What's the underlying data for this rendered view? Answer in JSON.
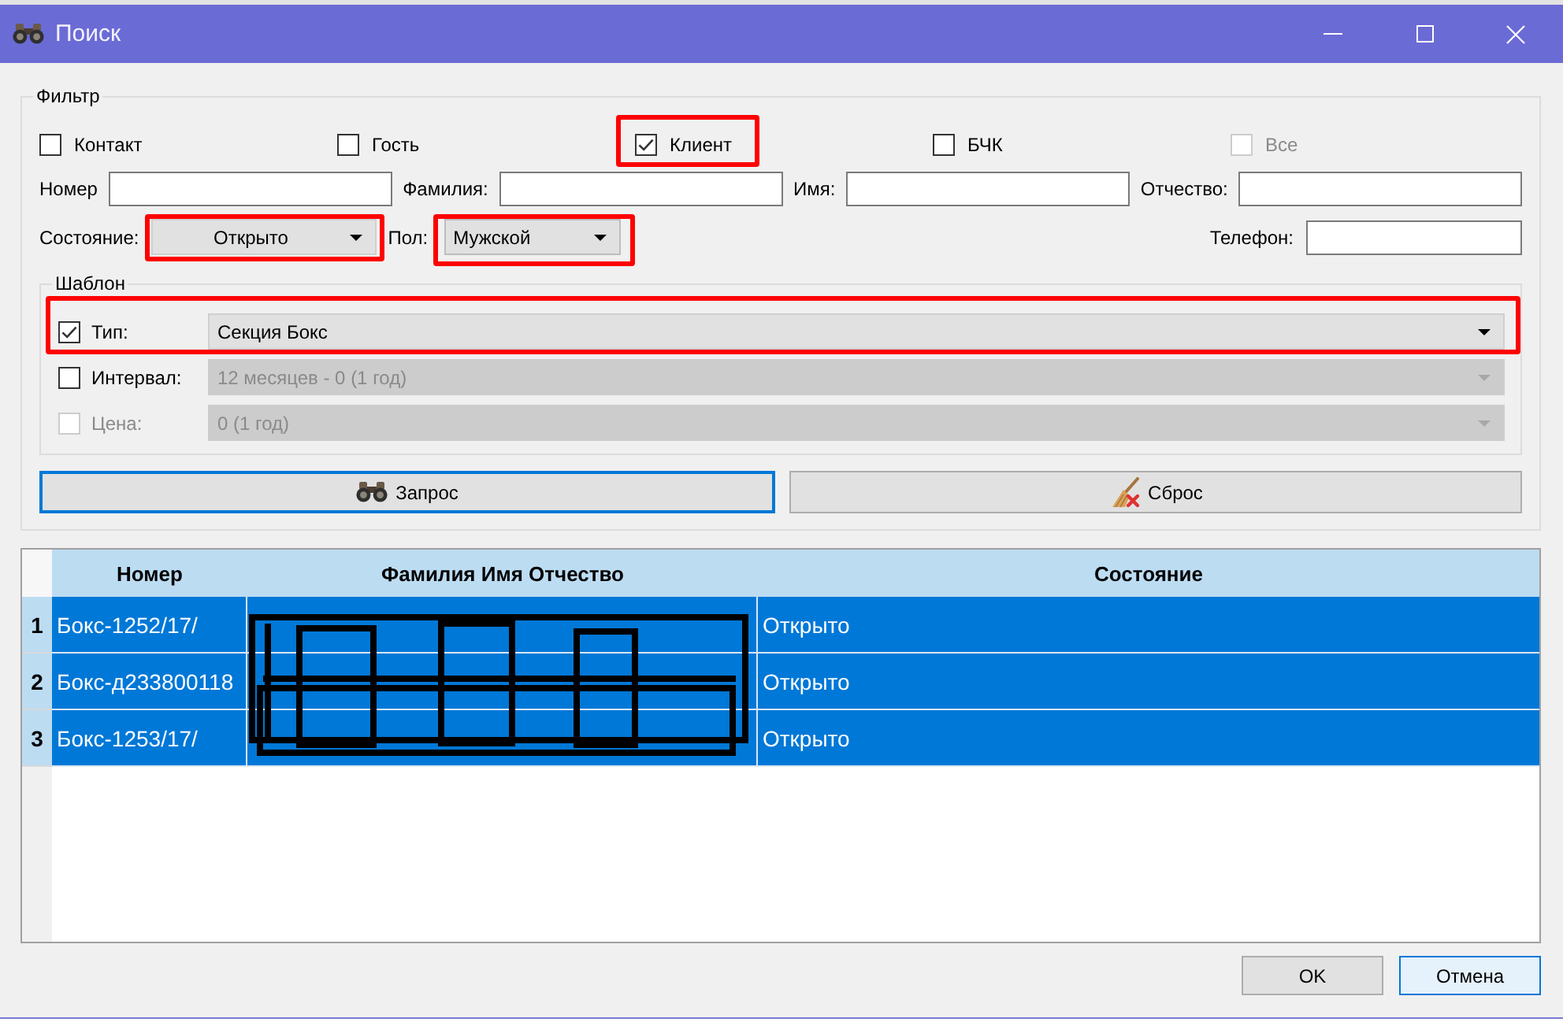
{
  "window": {
    "title": "Поиск"
  },
  "filter": {
    "legend": "Фильтр",
    "checkboxes": [
      {
        "label": "Контакт",
        "checked": false,
        "disabled": false,
        "highlighted": false
      },
      {
        "label": "Гость",
        "checked": false,
        "disabled": false,
        "highlighted": false
      },
      {
        "label": "Клиент",
        "checked": true,
        "disabled": false,
        "highlighted": true
      },
      {
        "label": "БЧК",
        "checked": false,
        "disabled": false,
        "highlighted": false
      },
      {
        "label": "Все",
        "checked": false,
        "disabled": true,
        "highlighted": false
      }
    ],
    "fields": [
      {
        "label": "Номер"
      },
      {
        "label": "Фамилия:"
      },
      {
        "label": "Имя:"
      },
      {
        "label": "Отчество:"
      }
    ],
    "state": {
      "label": "Состояние:",
      "value": "Открыто",
      "highlighted": true
    },
    "gender": {
      "label": "Пол:",
      "value": "Мужской",
      "highlighted": true
    },
    "phone": {
      "label": "Телефон:"
    },
    "template": {
      "legend": "Шаблон",
      "rows": [
        {
          "label": "Тип:",
          "value": "Секция Бокс",
          "checked": true,
          "disabled": false,
          "highlighted": true
        },
        {
          "label": "Интервал:",
          "value": "12 месяцев - 0 (1 год)",
          "checked": false,
          "disabled": false,
          "highlighted": false
        },
        {
          "label": "Цена:",
          "value": "0 (1 год)",
          "checked": false,
          "disabled": true,
          "highlighted": false
        }
      ]
    },
    "buttons": [
      {
        "label": "Запрос",
        "kind": "query",
        "focused": true
      },
      {
        "label": "Сброс",
        "kind": "reset",
        "focused": false
      }
    ]
  },
  "table": {
    "columns": [
      "Номер",
      "Фамилия Имя Отчество",
      "Состояние"
    ],
    "name_column_redacted": true,
    "rows": [
      {
        "row_number": "1",
        "number": "Бокс-1252/17/",
        "status": "Открыто",
        "selected": true
      },
      {
        "row_number": "2",
        "number": "Бокс-д233800118",
        "status": "Открыто",
        "selected": true
      },
      {
        "row_number": "3",
        "number": "Бокс-1253/17/",
        "status": "Открыто",
        "selected": true
      }
    ]
  },
  "footer_buttons": [
    {
      "label": "OK",
      "focused": false
    },
    {
      "label": "Отмена",
      "focused": true
    }
  ]
}
